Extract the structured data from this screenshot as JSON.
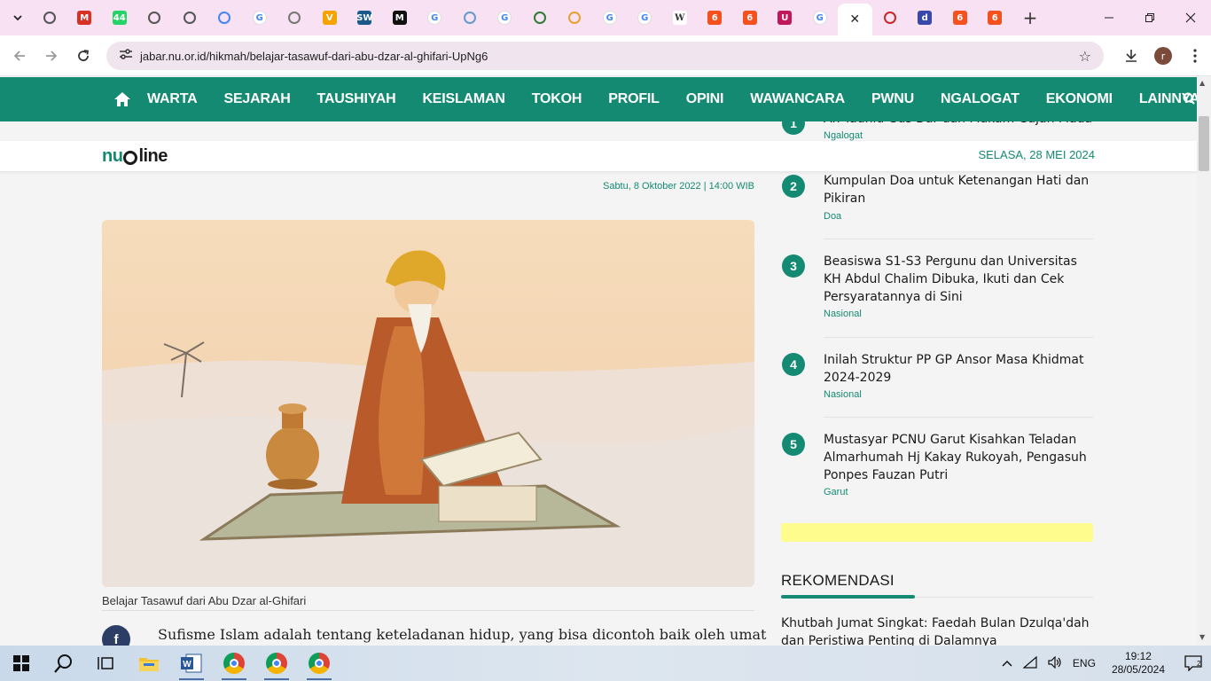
{
  "browser": {
    "tabs": [
      {
        "icon": "chrome-icon",
        "color": "#555555",
        "glyph": ""
      },
      {
        "icon": "gmail-icon",
        "color": "#d93025",
        "glyph": "M"
      },
      {
        "icon": "whatsapp-icon",
        "color": "#25d366",
        "glyph": "44"
      },
      {
        "icon": "globe-icon",
        "color": "#555555",
        "glyph": ""
      },
      {
        "icon": "globe-icon",
        "color": "#555555",
        "glyph": ""
      },
      {
        "icon": "docs-icon",
        "color": "#4285f4",
        "glyph": ""
      },
      {
        "icon": "google-icon",
        "color": "#4285f4",
        "glyph": "G"
      },
      {
        "icon": "globe-icon",
        "color": "#777777",
        "glyph": ""
      },
      {
        "icon": "v-icon",
        "color": "#f4a300",
        "glyph": "V"
      },
      {
        "icon": "sw-icon",
        "color": "#1a5a8a",
        "glyph": "SW"
      },
      {
        "icon": "m-icon",
        "color": "#111111",
        "glyph": "M"
      },
      {
        "icon": "google-icon",
        "color": "#4285f4",
        "glyph": "G"
      },
      {
        "icon": "search-icon",
        "color": "#6699cc",
        "glyph": ""
      },
      {
        "icon": "google-icon",
        "color": "#4285f4",
        "glyph": "G"
      },
      {
        "icon": "green-circle-icon",
        "color": "#2e7d32",
        "glyph": ""
      },
      {
        "icon": "flower-icon",
        "color": "#e8a030",
        "glyph": ""
      },
      {
        "icon": "google-icon",
        "color": "#4285f4",
        "glyph": "G"
      },
      {
        "icon": "google-icon",
        "color": "#4285f4",
        "glyph": "G"
      },
      {
        "icon": "wikipedia-icon",
        "color": "#333333",
        "glyph": "W"
      },
      {
        "icon": "six-icon",
        "color": "#f4511e",
        "glyph": "6"
      },
      {
        "icon": "six-icon",
        "color": "#f4511e",
        "glyph": "6"
      },
      {
        "icon": "u-icon",
        "color": "#c2185b",
        "glyph": "U"
      },
      {
        "icon": "google-icon",
        "color": "#4285f4",
        "glyph": "G"
      },
      {
        "icon": "close-icon",
        "color": "#222222",
        "glyph": "✕",
        "active": true
      },
      {
        "icon": "red-badge-icon",
        "color": "#c62828",
        "glyph": ""
      },
      {
        "icon": "d-icon",
        "color": "#3949ab",
        "glyph": "d"
      },
      {
        "icon": "six-icon",
        "color": "#f4511e",
        "glyph": "6"
      },
      {
        "icon": "six-icon",
        "color": "#f4511e",
        "glyph": "6"
      }
    ],
    "url": "jabar.nu.or.id/hikmah/belajar-tasawuf-dari-abu-dzar-al-ghifari-UpNg6",
    "avatar_letter": "r"
  },
  "site": {
    "nav": [
      "WARTA",
      "SEJARAH",
      "TAUSHIYAH",
      "KEISLAMAN",
      "TOKOH",
      "PROFIL",
      "OPINI",
      "WAWANCARA",
      "PWNU",
      "NGALOGAT",
      "EKONOMI",
      "LAINNYA"
    ],
    "logo_nu": "nu",
    "logo_line": "line",
    "date": "SELASA, 28 MEI 2024",
    "accent": "#148a72"
  },
  "article": {
    "published": "Sabtu, 8 Oktober 2022 | 14:00 WIB",
    "caption": "Belajar Tasawuf dari Abu Dzar al-Ghifari",
    "share_fb": "f",
    "body": "Sufisme Islam adalah tentang keteladanan hidup, yang bisa dicontoh baik oleh umat"
  },
  "sidebar": {
    "popular": [
      {
        "num": "1",
        "title": "Ah Tauhid Gus Dar dan Makam Gajah Mada",
        "category": "Ngalogat"
      },
      {
        "num": "2",
        "title": "Kumpulan Doa untuk Ketenangan Hati dan Pikiran",
        "category": "Doa"
      },
      {
        "num": "3",
        "title": "Beasiswa S1-S3 Pergunu dan Universitas KH Abdul Chalim Dibuka, Ikuti dan Cek Persyaratannya di Sini",
        "category": "Nasional"
      },
      {
        "num": "4",
        "title": "Inilah Struktur PP GP Ansor Masa Khidmat 2024-2029",
        "category": "Nasional"
      },
      {
        "num": "5",
        "title": "Mustasyar PCNU Garut Kisahkan Teladan Almarhumah Hj Kakay Rukoyah, Pengasuh Ponpes Fauzan Putri",
        "category": "Garut"
      }
    ],
    "rekomendasi_title": "REKOMENDASI",
    "rekomendasi_item": "Khutbah Jumat Singkat: Faedah Bulan Dzulqa'dah dan Peristiwa Penting di Dalamnya"
  },
  "taskbar": {
    "lang": "ENG",
    "time": "19:12",
    "date": "28/05/2024",
    "notif_count": "2"
  }
}
